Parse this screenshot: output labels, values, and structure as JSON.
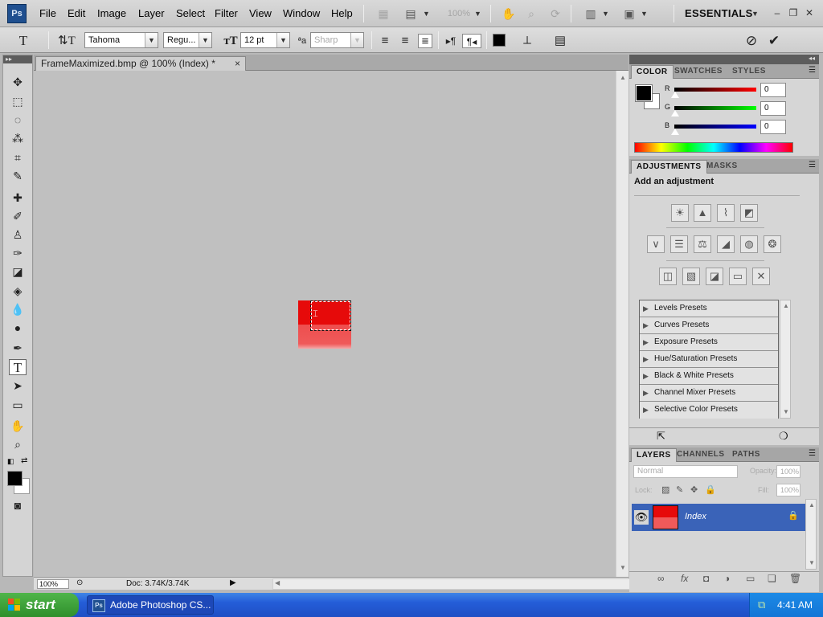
{
  "app": {
    "logo": "Ps",
    "menus": [
      "File",
      "Edit",
      "Image",
      "Layer",
      "Select",
      "Filter",
      "View",
      "Window",
      "Help"
    ],
    "zoom_readout": "100%",
    "workspace": "ESSENTIALS"
  },
  "options": {
    "font_family": "Tahoma",
    "font_style": "Regu...",
    "font_size": "12 pt",
    "antialias": "Sharp"
  },
  "document": {
    "tab_title": "FrameMaximized.bmp @ 100% (Index) *",
    "close_glyph": "×",
    "status_zoom": "100%",
    "doc_size": "Doc: 3.74K/3.74K"
  },
  "color_panel": {
    "tabs": [
      "COLOR",
      "SWATCHES",
      "STYLES"
    ],
    "r_label": "R",
    "g_label": "G",
    "b_label": "B",
    "r_value": "0",
    "g_value": "0",
    "b_value": "0"
  },
  "adjustments_panel": {
    "tabs": [
      "ADJUSTMENTS",
      "MASKS"
    ],
    "heading": "Add an adjustment",
    "presets": [
      "Levels Presets",
      "Curves Presets",
      "Exposure Presets",
      "Hue/Saturation Presets",
      "Black & White Presets",
      "Channel Mixer Presets",
      "Selective Color Presets"
    ]
  },
  "layers_panel": {
    "tabs": [
      "LAYERS",
      "CHANNELS",
      "PATHS"
    ],
    "blend_mode": "Normal",
    "opacity": "100%",
    "fill": "100%",
    "layer_name": "Index",
    "accent": "#3a63b8"
  },
  "taskbar": {
    "start": "start",
    "task": "Adobe Photoshop CS...",
    "clock": "4:41 AM"
  }
}
